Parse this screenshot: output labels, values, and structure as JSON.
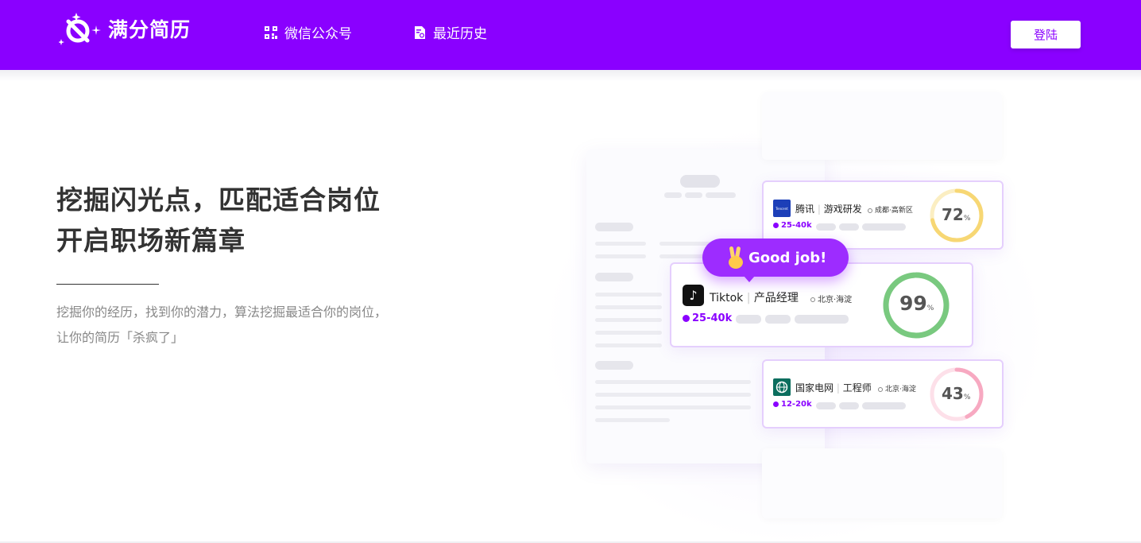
{
  "header": {
    "brand": "满分简历",
    "nav": [
      {
        "label": "微信公众号",
        "icon": "qr-code-icon"
      },
      {
        "label": "最近历史",
        "icon": "history-icon"
      }
    ],
    "login_label": "登陆",
    "colors": {
      "brand": "#8a00ff",
      "header_bg": "#8a00ff"
    }
  },
  "hero": {
    "title_line1": "挖掘闪光点，匹配适合岗位",
    "title_line2": "开启职场新篇章",
    "subtitle_line1": "挖掘你的经历，找到你的潜力，算法挖掘最适合你的岗位，",
    "subtitle_line2": "让你的简历「杀疯了」"
  },
  "illustration": {
    "badge": "Good job!",
    "jobs": [
      {
        "logo_text": "Tencent",
        "company": "腾讯",
        "role": "游戏研发",
        "location": "成都·高新区",
        "salary": "25-40k",
        "score": "72",
        "unit": "%",
        "score_color": "#f7d774"
      },
      {
        "logo_text": "Tiktok",
        "company": "Tiktok",
        "role": "产品经理",
        "location": "北京·海淀",
        "salary": "25-40k",
        "score": "99",
        "unit": "%",
        "score_color": "#79c97f"
      },
      {
        "logo_text": "国家电网",
        "company": "国家电网",
        "role": "工程师",
        "location": "北京·海淀",
        "salary": "12-20k",
        "score": "43",
        "unit": "%",
        "score_color": "#f7a9c1"
      }
    ]
  }
}
